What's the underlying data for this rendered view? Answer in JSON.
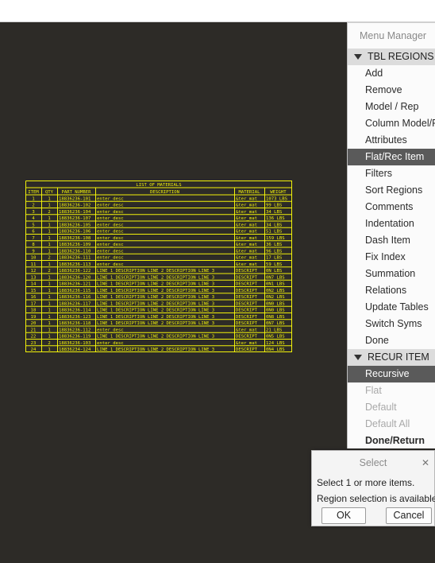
{
  "drawing": {
    "title": "LIST OF MATERIALS",
    "headers": [
      "ITEM",
      "QTY",
      "PART NUMBER",
      "DESCRIPTION",
      "MATERIAL",
      "WEIGHT"
    ],
    "rows": [
      [
        "1",
        "1",
        "18836236-101",
        "enter_desc",
        "&ter_mat",
        "1073 LBS"
      ],
      [
        "2",
        "1",
        "18836236-102",
        "enter_desc",
        "&ter_mat",
        "99 LBS"
      ],
      [
        "3",
        "2",
        "18836236-104",
        "enter_desc",
        "&ter_mat",
        "34 LBS"
      ],
      [
        "4",
        "1",
        "18836236-107",
        "enter_desc",
        "&ter_mat",
        "136 LBS"
      ],
      [
        "5",
        "1",
        "18836236-105",
        "enter_desc",
        "&ter_mat",
        "34 LBS"
      ],
      [
        "6",
        "1",
        "18836236-106",
        "enter_desc",
        "&ter_mat",
        "51 LBS"
      ],
      [
        "7",
        "1",
        "18836236-108",
        "enter_desc",
        "&ter_mat",
        "159 LBS"
      ],
      [
        "8",
        "1",
        "18836236-109",
        "enter_desc",
        "&ter_mat",
        "36 LBS"
      ],
      [
        "9",
        "1",
        "18836236-110",
        "enter_desc",
        "&ter_mat",
        "96 LBS"
      ],
      [
        "10",
        "2",
        "18836236-111",
        "enter_desc",
        "&ter_mat",
        "17 LBS"
      ],
      [
        "11",
        "1",
        "18836236-113",
        "enter_desc",
        "&ter_mat",
        "59 LBS"
      ],
      [
        "12",
        "2",
        "18836236-122",
        "LINE 1 DESCRIPTION LINE 2 DESCRIPTION LINE 3",
        "DESCRIPT",
        "0N LBS"
      ],
      [
        "13",
        "1",
        "18836236-120",
        "LINE 1 DESCRIPTION LINE 2 DESCRIPTION LINE 3",
        "DESCRIPT",
        "0N7 LBS"
      ],
      [
        "14",
        "1",
        "18836236-121",
        "LINE 1 DESCRIPTION LINE 2 DESCRIPTION LINE 3",
        "DESCRIPT",
        "0N1 LBS"
      ],
      [
        "15",
        "1",
        "18836236-115",
        "LINE 1 DESCRIPTION LINE 2 DESCRIPTION LINE 3",
        "DESCRIPT",
        "0N2 LBS"
      ],
      [
        "16",
        "1",
        "18836236-116",
        "LINE 1 DESCRIPTION LINE 2 DESCRIPTION LINE 3",
        "DESCRIPT",
        "0N2 LBS"
      ],
      [
        "17",
        "1",
        "18836236-117",
        "LINE 1 DESCRIPTION LINE 2 DESCRIPTION LINE 3",
        "DESCRIPT",
        "0N0 LBS"
      ],
      [
        "18",
        "1",
        "18836236-114",
        "LINE 1 DESCRIPTION LINE 2 DESCRIPTION LINE 3",
        "DESCRIPT",
        "0N0 LBS"
      ],
      [
        "19",
        "1",
        "18836236-123",
        "LINE 1 DESCRIPTION LINE 2 DESCRIPTION LINE 3",
        "DESCRIPT",
        "0N8 LBS"
      ],
      [
        "20",
        "1",
        "18836236-118",
        "LINE 1 DESCRIPTION LINE 2 DESCRIPTION LINE 3",
        "DESCRIPT",
        "0N7 LBS"
      ],
      [
        "21",
        "1",
        "18836236-112",
        "enter_desc",
        "&ter_mat",
        "21 LBS"
      ],
      [
        "22",
        "1",
        "18836236-119",
        "LINE 1 DESCRIPTION LINE 2 DESCRIPTION LINE 3",
        "DESCRIPT",
        "0N5 LBS"
      ],
      [
        "23",
        "2",
        "18836236-103",
        "enter_desc",
        "&ter_mat",
        "124 LBS"
      ],
      [
        "24",
        "1",
        "18836234-124",
        "LINE 1 DESCRIPTION LINE 2 DESCRIPTION LINE 3",
        "DESCRIPT",
        "0N4 LBS"
      ]
    ],
    "line_color": "#f2f20a"
  },
  "menu": {
    "title": "Menu Manager",
    "tbl_regions": {
      "label": "TBL REGIONS",
      "items": [
        "Add",
        "Remove",
        "Model / Rep",
        "Column Model/F",
        "Attributes",
        "Flat/Rec Item",
        "Filters",
        "Sort Regions",
        "Comments",
        "Indentation",
        "Dash Item",
        "Fix Index",
        "Summation",
        "Relations",
        "Update Tables",
        "Switch Syms",
        "Done"
      ],
      "selected": "Flat/Rec Item"
    },
    "recur_item": {
      "label": "RECUR ITEM",
      "items": [
        "Recursive",
        "Flat",
        "Default",
        "Default All",
        "Done/Return"
      ],
      "selected": "Recursive"
    }
  },
  "dialog": {
    "title": "Select",
    "close": "✕",
    "line1": "Select 1 or more items.",
    "line2": "Region selection is available.",
    "ok": "OK",
    "cancel": "Cancel"
  }
}
